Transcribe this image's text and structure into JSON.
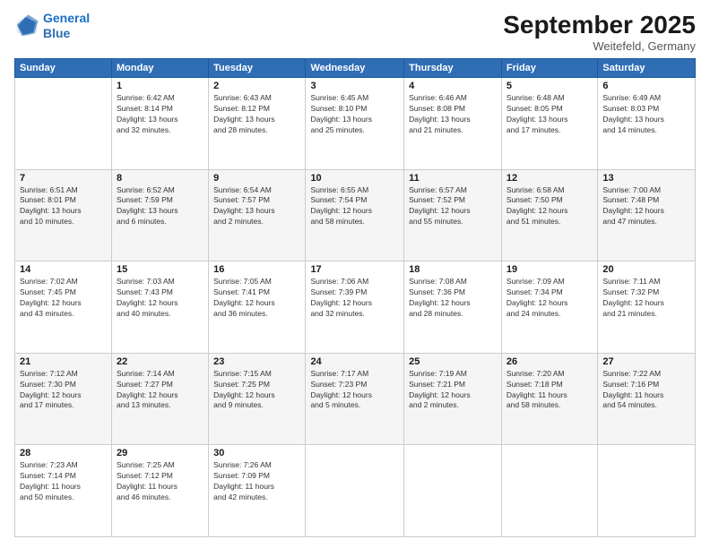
{
  "logo": {
    "line1": "General",
    "line2": "Blue"
  },
  "header": {
    "month": "September 2025",
    "location": "Weitefeld, Germany"
  },
  "days_of_week": [
    "Sunday",
    "Monday",
    "Tuesday",
    "Wednesday",
    "Thursday",
    "Friday",
    "Saturday"
  ],
  "weeks": [
    [
      {
        "day": "",
        "info": ""
      },
      {
        "day": "1",
        "info": "Sunrise: 6:42 AM\nSunset: 8:14 PM\nDaylight: 13 hours\nand 32 minutes."
      },
      {
        "day": "2",
        "info": "Sunrise: 6:43 AM\nSunset: 8:12 PM\nDaylight: 13 hours\nand 28 minutes."
      },
      {
        "day": "3",
        "info": "Sunrise: 6:45 AM\nSunset: 8:10 PM\nDaylight: 13 hours\nand 25 minutes."
      },
      {
        "day": "4",
        "info": "Sunrise: 6:46 AM\nSunset: 8:08 PM\nDaylight: 13 hours\nand 21 minutes."
      },
      {
        "day": "5",
        "info": "Sunrise: 6:48 AM\nSunset: 8:05 PM\nDaylight: 13 hours\nand 17 minutes."
      },
      {
        "day": "6",
        "info": "Sunrise: 6:49 AM\nSunset: 8:03 PM\nDaylight: 13 hours\nand 14 minutes."
      }
    ],
    [
      {
        "day": "7",
        "info": "Sunrise: 6:51 AM\nSunset: 8:01 PM\nDaylight: 13 hours\nand 10 minutes."
      },
      {
        "day": "8",
        "info": "Sunrise: 6:52 AM\nSunset: 7:59 PM\nDaylight: 13 hours\nand 6 minutes."
      },
      {
        "day": "9",
        "info": "Sunrise: 6:54 AM\nSunset: 7:57 PM\nDaylight: 13 hours\nand 2 minutes."
      },
      {
        "day": "10",
        "info": "Sunrise: 6:55 AM\nSunset: 7:54 PM\nDaylight: 12 hours\nand 58 minutes."
      },
      {
        "day": "11",
        "info": "Sunrise: 6:57 AM\nSunset: 7:52 PM\nDaylight: 12 hours\nand 55 minutes."
      },
      {
        "day": "12",
        "info": "Sunrise: 6:58 AM\nSunset: 7:50 PM\nDaylight: 12 hours\nand 51 minutes."
      },
      {
        "day": "13",
        "info": "Sunrise: 7:00 AM\nSunset: 7:48 PM\nDaylight: 12 hours\nand 47 minutes."
      }
    ],
    [
      {
        "day": "14",
        "info": "Sunrise: 7:02 AM\nSunset: 7:45 PM\nDaylight: 12 hours\nand 43 minutes."
      },
      {
        "day": "15",
        "info": "Sunrise: 7:03 AM\nSunset: 7:43 PM\nDaylight: 12 hours\nand 40 minutes."
      },
      {
        "day": "16",
        "info": "Sunrise: 7:05 AM\nSunset: 7:41 PM\nDaylight: 12 hours\nand 36 minutes."
      },
      {
        "day": "17",
        "info": "Sunrise: 7:06 AM\nSunset: 7:39 PM\nDaylight: 12 hours\nand 32 minutes."
      },
      {
        "day": "18",
        "info": "Sunrise: 7:08 AM\nSunset: 7:36 PM\nDaylight: 12 hours\nand 28 minutes."
      },
      {
        "day": "19",
        "info": "Sunrise: 7:09 AM\nSunset: 7:34 PM\nDaylight: 12 hours\nand 24 minutes."
      },
      {
        "day": "20",
        "info": "Sunrise: 7:11 AM\nSunset: 7:32 PM\nDaylight: 12 hours\nand 21 minutes."
      }
    ],
    [
      {
        "day": "21",
        "info": "Sunrise: 7:12 AM\nSunset: 7:30 PM\nDaylight: 12 hours\nand 17 minutes."
      },
      {
        "day": "22",
        "info": "Sunrise: 7:14 AM\nSunset: 7:27 PM\nDaylight: 12 hours\nand 13 minutes."
      },
      {
        "day": "23",
        "info": "Sunrise: 7:15 AM\nSunset: 7:25 PM\nDaylight: 12 hours\nand 9 minutes."
      },
      {
        "day": "24",
        "info": "Sunrise: 7:17 AM\nSunset: 7:23 PM\nDaylight: 12 hours\nand 5 minutes."
      },
      {
        "day": "25",
        "info": "Sunrise: 7:19 AM\nSunset: 7:21 PM\nDaylight: 12 hours\nand 2 minutes."
      },
      {
        "day": "26",
        "info": "Sunrise: 7:20 AM\nSunset: 7:18 PM\nDaylight: 11 hours\nand 58 minutes."
      },
      {
        "day": "27",
        "info": "Sunrise: 7:22 AM\nSunset: 7:16 PM\nDaylight: 11 hours\nand 54 minutes."
      }
    ],
    [
      {
        "day": "28",
        "info": "Sunrise: 7:23 AM\nSunset: 7:14 PM\nDaylight: 11 hours\nand 50 minutes."
      },
      {
        "day": "29",
        "info": "Sunrise: 7:25 AM\nSunset: 7:12 PM\nDaylight: 11 hours\nand 46 minutes."
      },
      {
        "day": "30",
        "info": "Sunrise: 7:26 AM\nSunset: 7:09 PM\nDaylight: 11 hours\nand 42 minutes."
      },
      {
        "day": "",
        "info": ""
      },
      {
        "day": "",
        "info": ""
      },
      {
        "day": "",
        "info": ""
      },
      {
        "day": "",
        "info": ""
      }
    ]
  ]
}
